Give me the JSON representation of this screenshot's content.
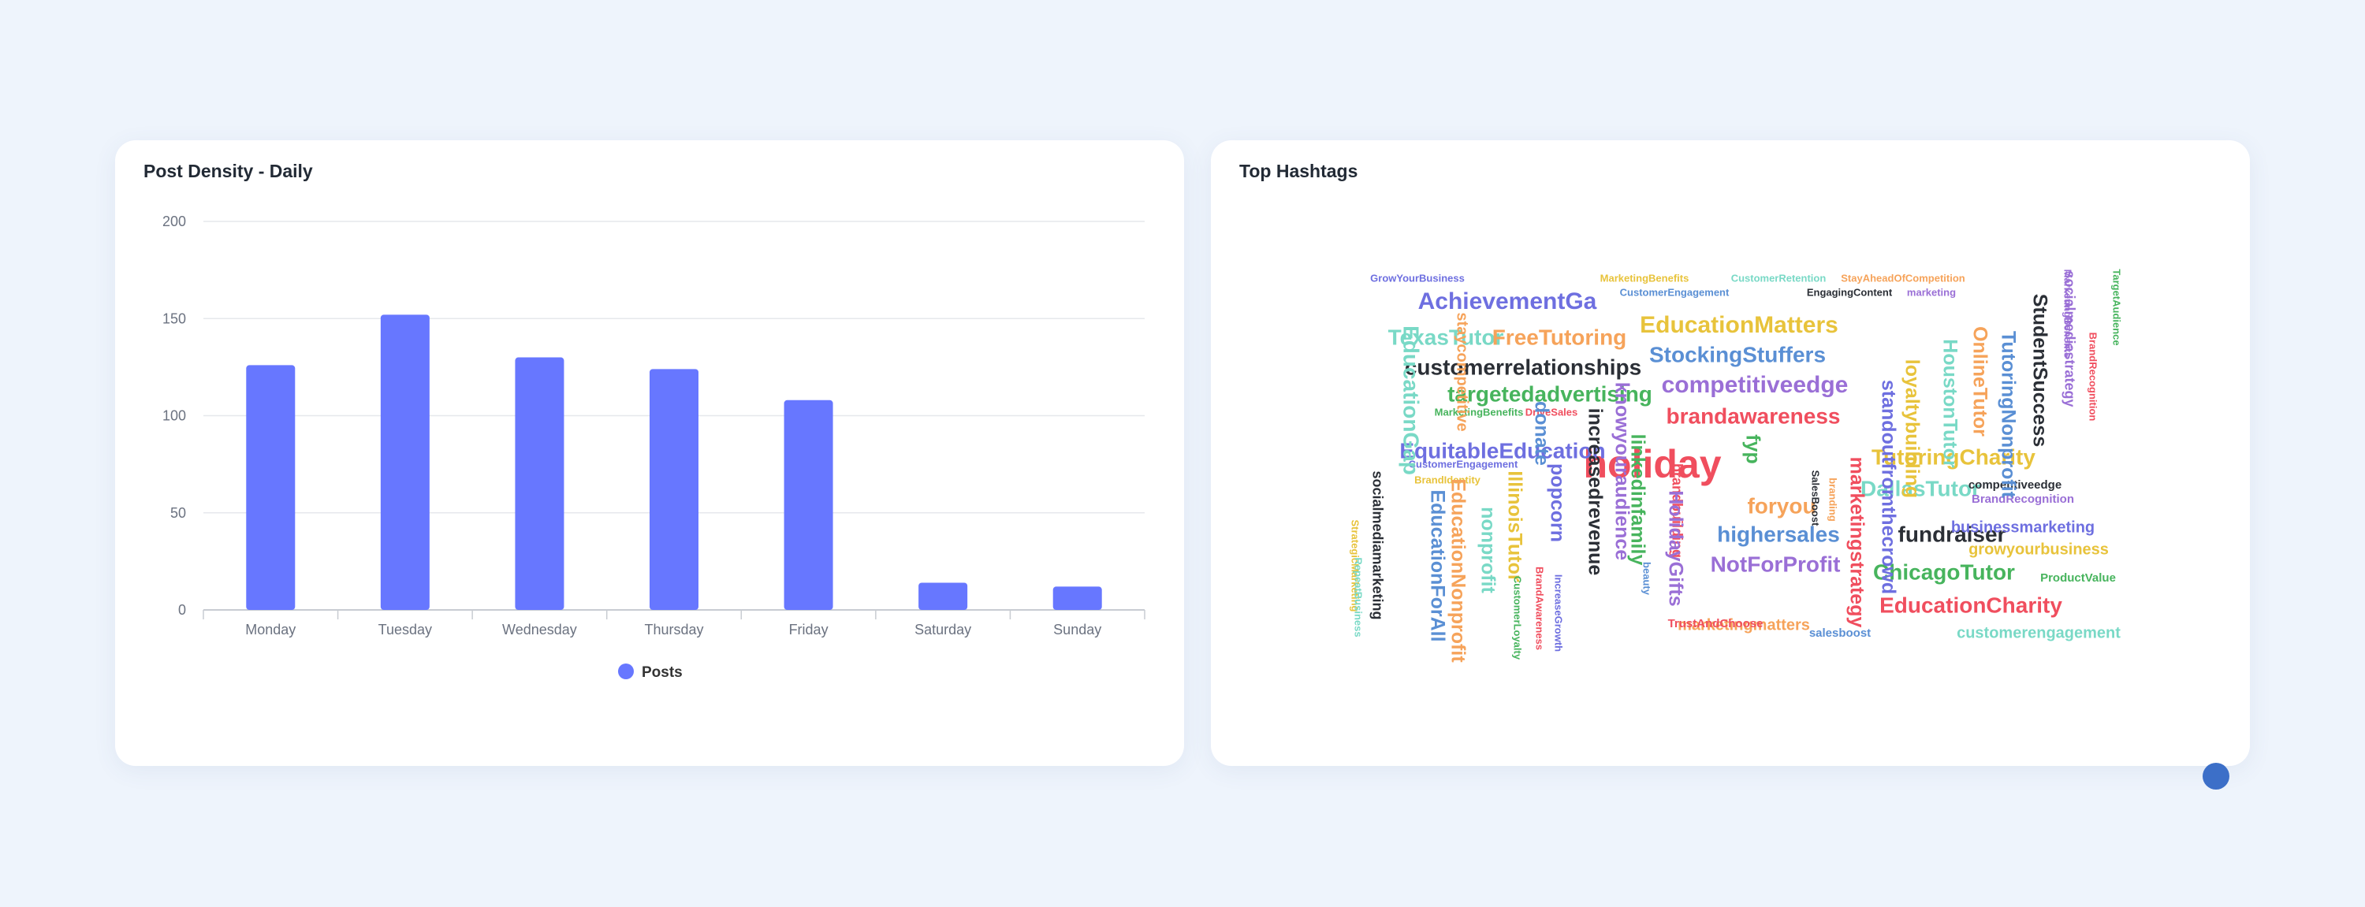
{
  "panels": {
    "density_title": "Post Density - Daily",
    "hashtags_title": "Top Hashtags"
  },
  "colors": {
    "bar": "#6777ff",
    "grid": "#e6e8ec",
    "axis": "#c8ccd2",
    "cloud_palette": [
      "#f04e5e",
      "#6e6fe0",
      "#e8c33b",
      "#79d9c6",
      "#f6a35a",
      "#5a8fd4",
      "#2b2f36",
      "#9a6fd6",
      "#47b45d"
    ]
  },
  "chart_data": [
    {
      "type": "bar",
      "categories": [
        "Monday",
        "Tuesday",
        "Wednesday",
        "Thursday",
        "Friday",
        "Saturday",
        "Sunday"
      ],
      "series": [
        {
          "name": "Posts",
          "values": [
            126,
            152,
            130,
            124,
            108,
            14,
            12
          ]
        }
      ],
      "title": "Post Density - Daily",
      "xlabel": "",
      "ylabel": "",
      "ylim": [
        0,
        200
      ],
      "yticks": [
        0,
        50,
        100,
        150,
        200
      ],
      "grid": true,
      "legend": "bottom"
    },
    {
      "type": "other",
      "title": "Top Hashtags",
      "words": [
        {
          "text": "holiday",
          "weight": 10,
          "rotate": 0
        },
        {
          "text": "AchievementGa",
          "weight": 6,
          "rotate": 0
        },
        {
          "text": "EducationMatters",
          "weight": 6,
          "rotate": 0
        },
        {
          "text": "TexasTutor",
          "weight": 5.5,
          "rotate": 0
        },
        {
          "text": "FreeTutoring",
          "weight": 5.5,
          "rotate": 0
        },
        {
          "text": "StockingStuffers",
          "weight": 5.5,
          "rotate": 0
        },
        {
          "text": "customerrelationships",
          "weight": 5.5,
          "rotate": 0
        },
        {
          "text": "competitiveedge",
          "weight": 6,
          "rotate": 0
        },
        {
          "text": "targetedadvertising",
          "weight": 5.5,
          "rotate": 0
        },
        {
          "text": "brandawareness",
          "weight": 5.5,
          "rotate": 0
        },
        {
          "text": "EquitableEducation",
          "weight": 5.5,
          "rotate": 0
        },
        {
          "text": "TutoringCharity",
          "weight": 5.5,
          "rotate": 0
        },
        {
          "text": "DallasTutor",
          "weight": 5.5,
          "rotate": 0
        },
        {
          "text": "foryou",
          "weight": 5.5,
          "rotate": 0
        },
        {
          "text": "highersales",
          "weight": 5.5,
          "rotate": 0
        },
        {
          "text": "fundraiser",
          "weight": 5.5,
          "rotate": 0
        },
        {
          "text": "NotForProfit",
          "weight": 5.5,
          "rotate": 0
        },
        {
          "text": "ChicagoTutor",
          "weight": 5.5,
          "rotate": 0
        },
        {
          "text": "EducationCharity",
          "weight": 5.5,
          "rotate": 0
        },
        {
          "text": "businessmarketing",
          "weight": 4,
          "rotate": 0
        },
        {
          "text": "growyourbusiness",
          "weight": 4,
          "rotate": 0
        },
        {
          "text": "customerengagement",
          "weight": 4,
          "rotate": 0
        },
        {
          "text": "marketingmatters",
          "weight": 4,
          "rotate": 0
        },
        {
          "text": "salesboost",
          "weight": 3,
          "rotate": 0
        },
        {
          "text": "competitiveedge",
          "weight": 3,
          "rotate": 0
        },
        {
          "text": "BrandRecognition",
          "weight": 3,
          "rotate": 0
        },
        {
          "text": "ProductValue",
          "weight": 3,
          "rotate": 0
        },
        {
          "text": "TrustAndChoose",
          "weight": 3,
          "rotate": 0
        },
        {
          "text": "GrowYourBusiness",
          "weight": 2.5,
          "rotate": 0
        },
        {
          "text": "MarketingBenefits",
          "weight": 2.5,
          "rotate": 0
        },
        {
          "text": "CustomerRetention",
          "weight": 2.5,
          "rotate": 0
        },
        {
          "text": "StayAheadOfCompetition",
          "weight": 2.5,
          "rotate": 0
        },
        {
          "text": "CustomerEngagement",
          "weight": 2.5,
          "rotate": 0
        },
        {
          "text": "EngagingContent",
          "weight": 2.5,
          "rotate": 0
        },
        {
          "text": "marketing",
          "weight": 2.5,
          "rotate": 0
        },
        {
          "text": "MarketingBenefits",
          "weight": 2.5,
          "rotate": 0
        },
        {
          "text": "DriveSales",
          "weight": 2.5,
          "rotate": 0
        },
        {
          "text": "CustomerEngagement",
          "weight": 2.5,
          "rotate": 0
        },
        {
          "text": "BrandIdentity",
          "weight": 2.5,
          "rotate": 0
        },
        {
          "text": "EducationGap",
          "weight": 5.5,
          "rotate": 90
        },
        {
          "text": "staycompetitive",
          "weight": 4,
          "rotate": 90
        },
        {
          "text": "donate",
          "weight": 5,
          "rotate": 90
        },
        {
          "text": "increasedrevenue",
          "weight": 5,
          "rotate": 90
        },
        {
          "text": "knowyouraudience",
          "weight": 5,
          "rotate": 90
        },
        {
          "text": "linkedinfamily",
          "weight": 5,
          "rotate": 90
        },
        {
          "text": "brandbuilding",
          "weight": 3.5,
          "rotate": 90
        },
        {
          "text": "popcorn",
          "weight": 5,
          "rotate": 90
        },
        {
          "text": "IllinoisTutor",
          "weight": 5,
          "rotate": 90
        },
        {
          "text": "nonprofit",
          "weight": 5,
          "rotate": 90
        },
        {
          "text": "EducationNonprofit",
          "weight": 5,
          "rotate": 90
        },
        {
          "text": "EducationForAll",
          "weight": 5,
          "rotate": 90
        },
        {
          "text": "socialmediamarketing",
          "weight": 3.5,
          "rotate": 90
        },
        {
          "text": "HolidayGifts",
          "weight": 5,
          "rotate": 90
        },
        {
          "text": "fyp",
          "weight": 5,
          "rotate": 90
        },
        {
          "text": "marketingstrategy",
          "weight": 5,
          "rotate": 90
        },
        {
          "text": "standoutfromthecrowd",
          "weight": 5,
          "rotate": 90
        },
        {
          "text": "loyaltybuilding",
          "weight": 5,
          "rotate": 90
        },
        {
          "text": "HoustonTutor",
          "weight": 5,
          "rotate": 90
        },
        {
          "text": "OnlineTutor",
          "weight": 5,
          "rotate": 90
        },
        {
          "text": "TutoringNonprofit",
          "weight": 5,
          "rotate": 90
        },
        {
          "text": "StudentSuccess",
          "weight": 5,
          "rotate": 90
        },
        {
          "text": "socialmediastrategy",
          "weight": 3.5,
          "rotate": 90
        },
        {
          "text": "CustomerLoyalty",
          "weight": 2.5,
          "rotate": 90
        },
        {
          "text": "BrandAwareness",
          "weight": 2.5,
          "rotate": 90
        },
        {
          "text": "IncreaseGrowth",
          "weight": 2.5,
          "rotate": 90
        },
        {
          "text": "StrategicMarketing",
          "weight": 2.5,
          "rotate": 90
        },
        {
          "text": "RepeatBusiness",
          "weight": 2.5,
          "rotate": 90
        },
        {
          "text": "branding",
          "weight": 2.5,
          "rotate": 90
        },
        {
          "text": "beauty",
          "weight": 2.5,
          "rotate": 90
        },
        {
          "text": "SalesBoost",
          "weight": 2.5,
          "rotate": 90
        },
        {
          "text": "MarketingBenefits",
          "weight": 2.5,
          "rotate": 90
        },
        {
          "text": "TargetAudience",
          "weight": 2.5,
          "rotate": 90
        },
        {
          "text": "BrandRecognition",
          "weight": 2.5,
          "rotate": 90
        }
      ]
    }
  ],
  "legend": {
    "label": "Posts"
  }
}
